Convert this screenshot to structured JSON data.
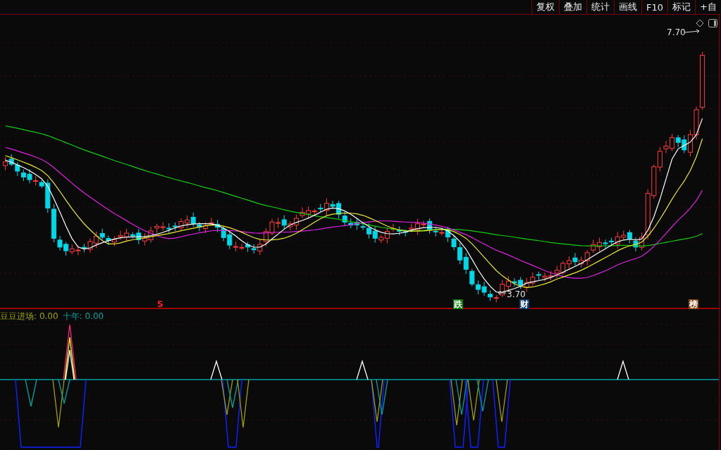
{
  "toolbar": {
    "buttons": [
      {
        "label": "复权"
      },
      {
        "label": "叠加"
      },
      {
        "label": "统计"
      },
      {
        "label": "画线"
      },
      {
        "label": "F10"
      },
      {
        "label": "标记"
      },
      {
        "label": "+自"
      }
    ]
  },
  "price_chart": {
    "high_label": "7.70",
    "low_label": "3.70",
    "signals": [
      {
        "label": "S",
        "kind": "sell"
      },
      {
        "label": "跌",
        "kind": "fall"
      },
      {
        "label": "财",
        "kind": "finance"
      },
      {
        "label": "榜",
        "kind": "rank"
      }
    ]
  },
  "indicator": {
    "legend": [
      {
        "name": "豆豆进场:",
        "value": "0.00",
        "color": "#a0a000"
      },
      {
        "name": "十年:",
        "value": "0.00",
        "color": "#00a0a0"
      }
    ]
  }
}
